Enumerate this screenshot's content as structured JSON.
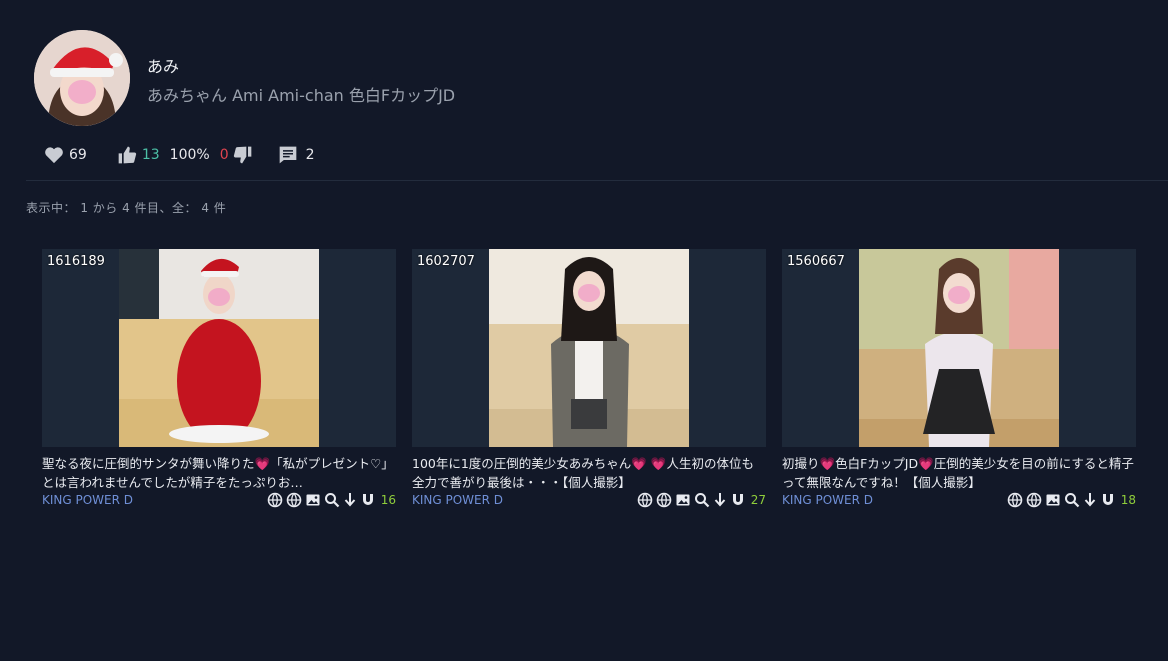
{
  "profile": {
    "name": "あみ",
    "description": "あみちゃん Ami Ami-chan 色白FカップJD"
  },
  "stats": {
    "likes": "69",
    "thumbs_up": "13",
    "percent": "100%",
    "thumbs_down": "0",
    "comments": "2"
  },
  "listing": {
    "showing": "表示中： 1 から 4 件目、全： 4 件"
  },
  "cards": [
    {
      "id": "1616189",
      "title_parts": [
        "聖なる夜に圧倒的サンタが舞い降りた",
        "「私がプレゼント♡」とは言われませんでしたが精子をたっぷりお…"
      ],
      "studio": "KING POWER D",
      "seeders": "16"
    },
    {
      "id": "1602707",
      "title_parts": [
        "100年に1度の圧倒的美少女あみちゃん",
        "",
        "人生初の体位も全力で善がり最後は・・・【個人撮影】"
      ],
      "studio": "KING POWER D",
      "seeders": "27"
    },
    {
      "id": "1560667",
      "title_parts": [
        "初撮り",
        "色白FカップJD",
        "圧倒的美少女を目の前にすると精子って無限なんですね！【個人撮影】"
      ],
      "studio": "KING POWER D",
      "seeders": "18"
    }
  ],
  "icons": {
    "heart": "heart-icon",
    "thumbs_up": "thumbs-up-icon",
    "thumbs_down": "thumbs-down-icon",
    "comment": "comment-icon",
    "card_actions": [
      "globe-icon",
      "globe-icon",
      "image-icon",
      "search-icon",
      "download-icon",
      "magnet-icon"
    ]
  },
  "colors": {
    "background": "#121828",
    "studio_link": "#6f8fd6",
    "seeders": "#8fce3b",
    "thumbs_up": "#4cc0a6",
    "thumbs_down": "#e0444f",
    "heart_emoji": "#e8456c"
  }
}
